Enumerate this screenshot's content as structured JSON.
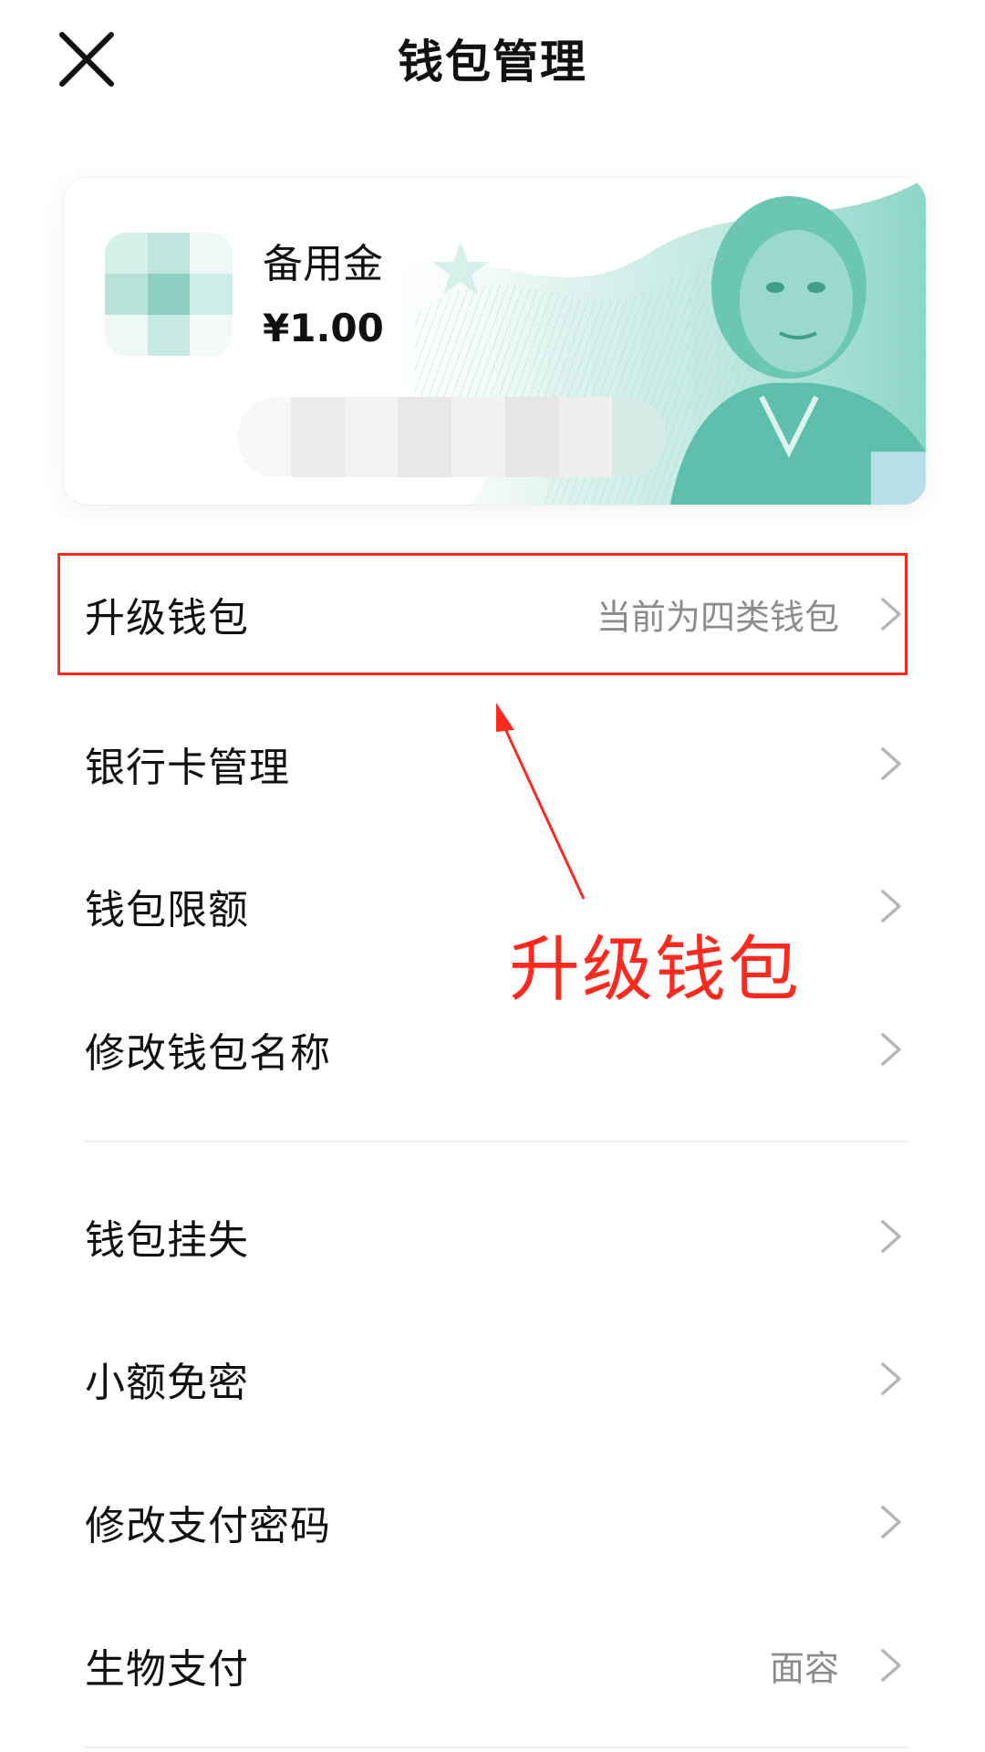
{
  "header": {
    "title": "钱包管理",
    "close_icon": "close-icon"
  },
  "wallet_card": {
    "name": "备用金",
    "balance": "¥1.00",
    "accent_color": "#5cc4b0"
  },
  "menu": {
    "upgrade": {
      "label": "升级钱包",
      "value": "当前为四类钱包"
    },
    "bank_card": {
      "label": "银行卡管理"
    },
    "limit": {
      "label": "钱包限额"
    },
    "rename": {
      "label": "修改钱包名称"
    },
    "report_loss": {
      "label": "钱包挂失"
    },
    "small_amount": {
      "label": "小额免密"
    },
    "pay_password": {
      "label": "修改支付密码"
    },
    "biometric": {
      "label": "生物支付",
      "value": "面容"
    }
  },
  "annotation": {
    "text": "升级钱包",
    "color": "#ff2a1f"
  }
}
